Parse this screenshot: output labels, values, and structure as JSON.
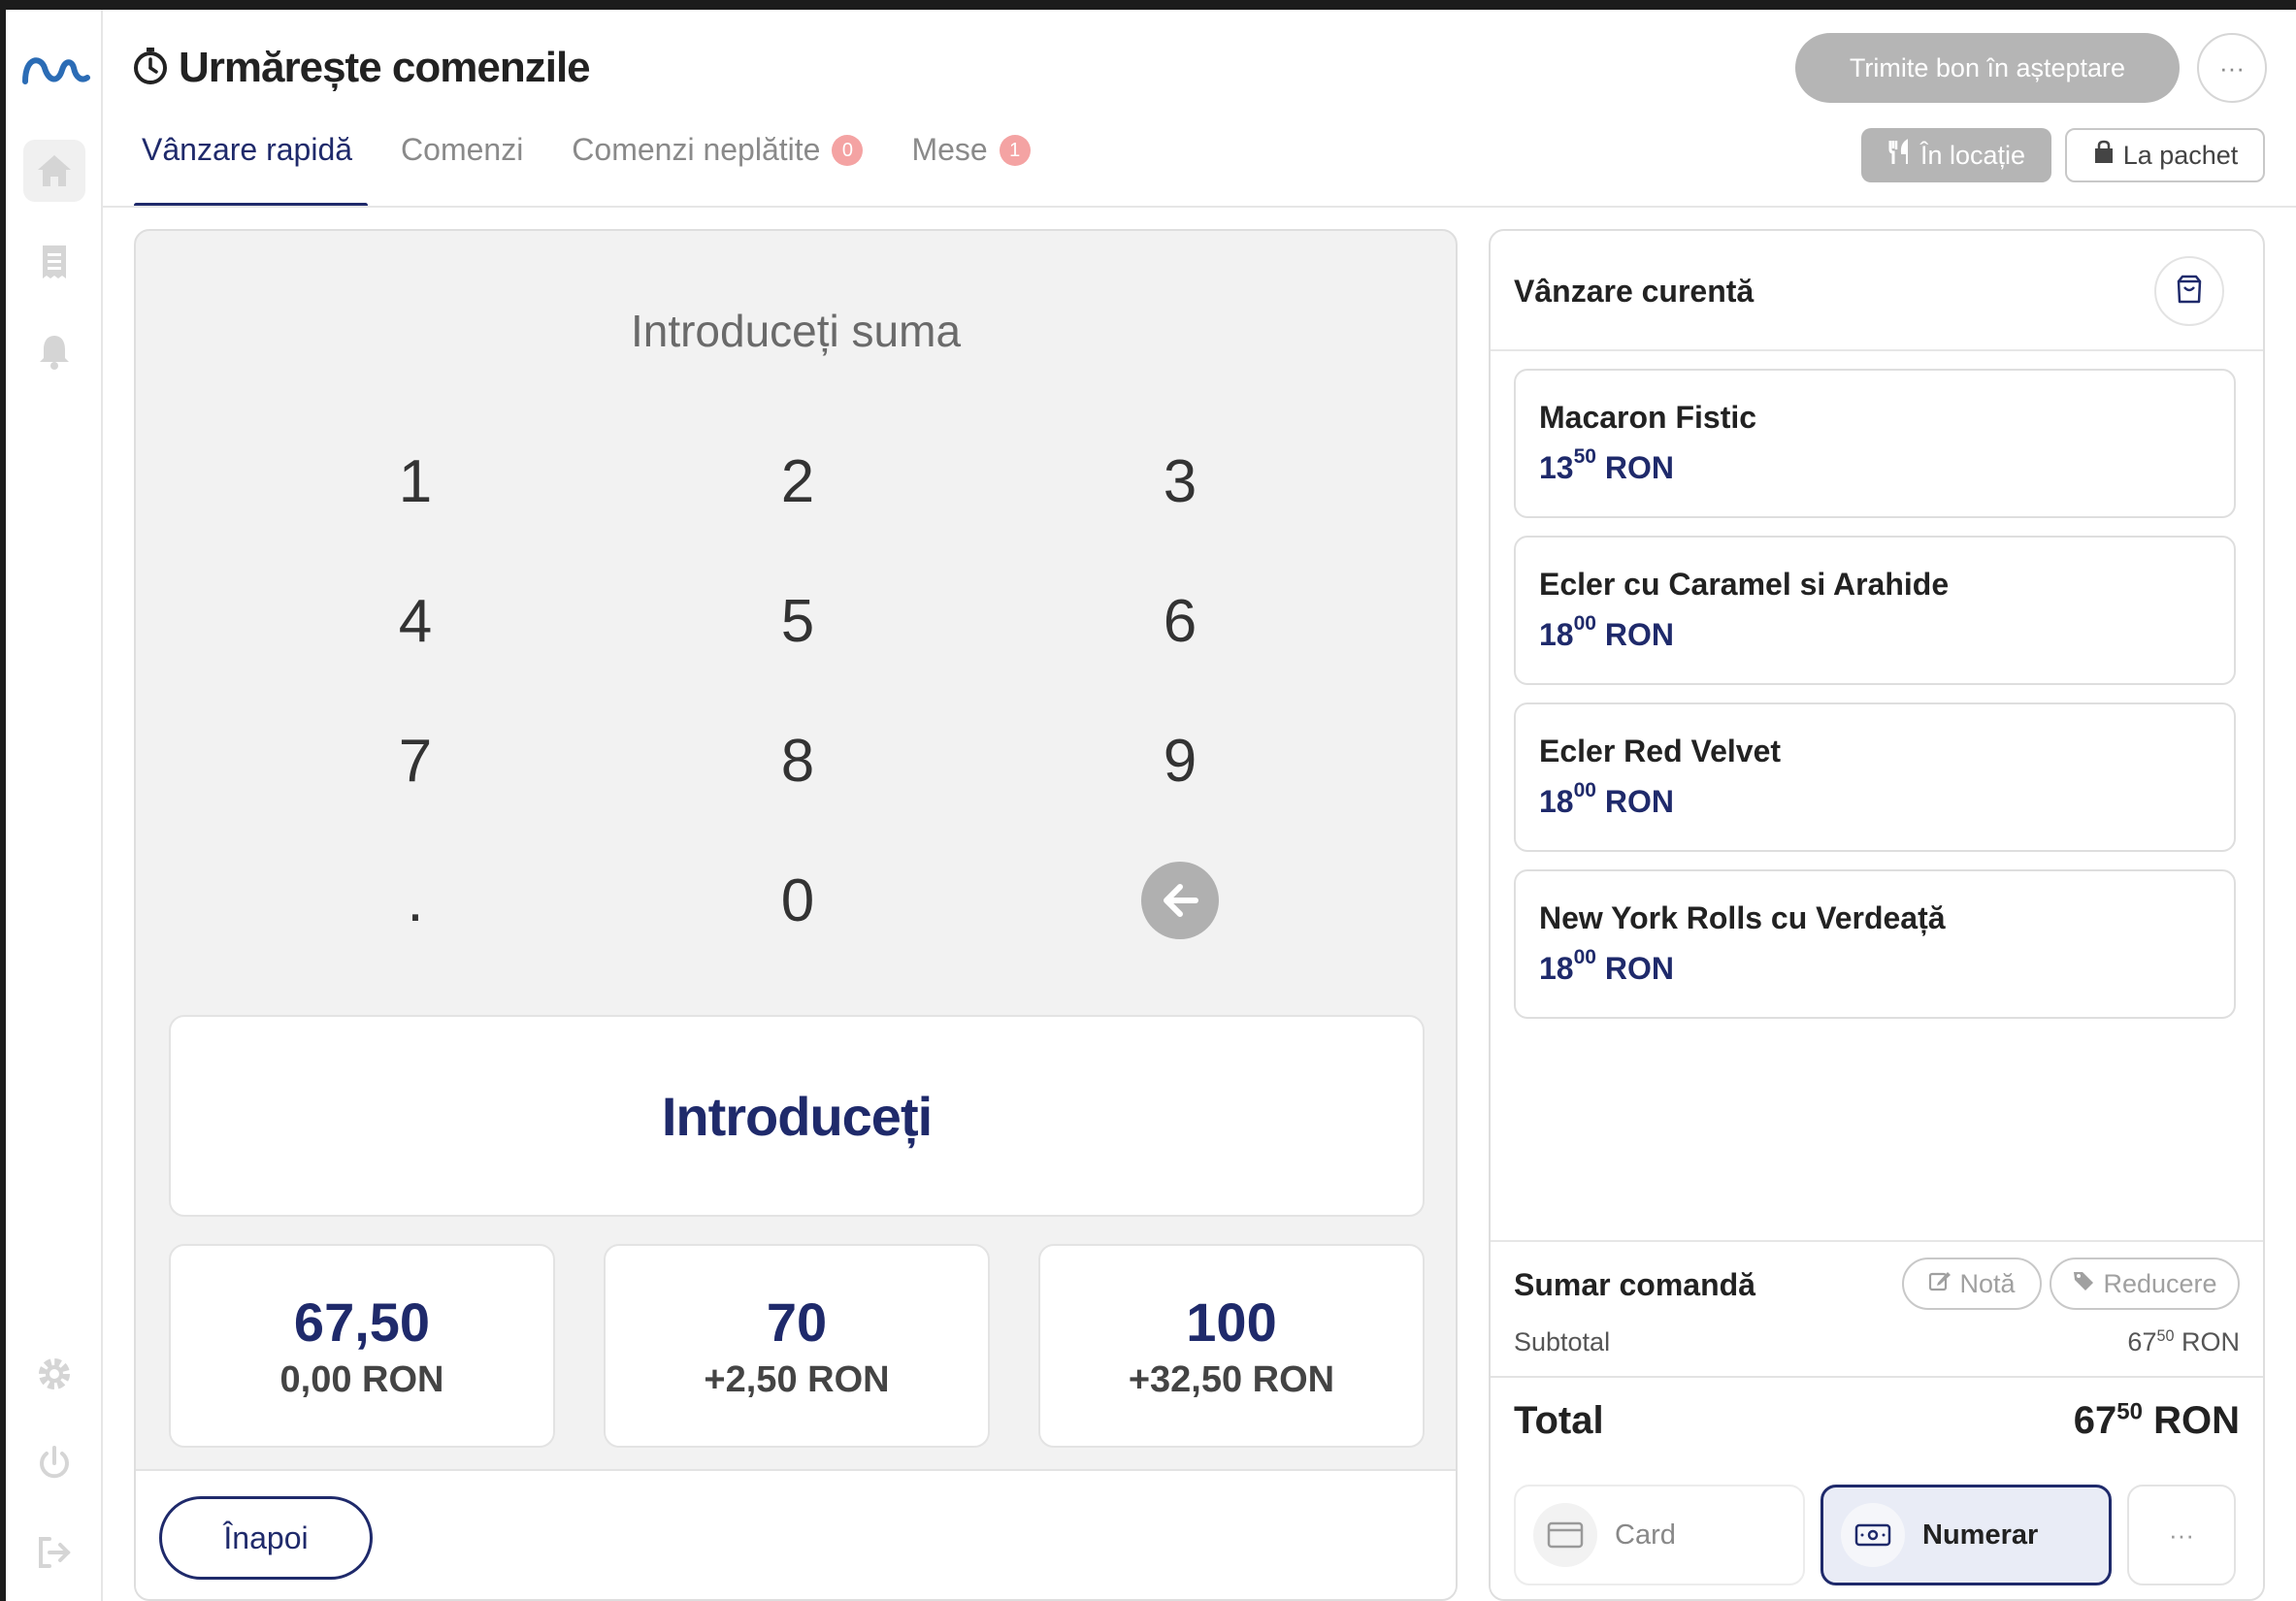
{
  "header": {
    "title": "Urmărește comenzile",
    "send_pending_label": "Trimite bon în așteptare",
    "more_label": "···"
  },
  "tabs": [
    {
      "label": "Vânzare rapidă",
      "active": true
    },
    {
      "label": "Comenzi"
    },
    {
      "label": "Comenzi neplătite",
      "badge": "0"
    },
    {
      "label": "Mese",
      "badge": "1"
    }
  ],
  "service_mode": {
    "in_location_label": "În locație",
    "takeaway_label": "La pachet"
  },
  "keypad": {
    "title": "Introduceți suma",
    "keys": [
      "1",
      "2",
      "3",
      "4",
      "5",
      "6",
      "7",
      "8",
      "9",
      ".",
      "0"
    ],
    "enter_label": "Introduceți",
    "quick_amounts": [
      {
        "amount": "67,50",
        "change": "0,00 RON"
      },
      {
        "amount": "70",
        "change": "+2,50 RON"
      },
      {
        "amount": "100",
        "change": "+32,50 RON"
      }
    ],
    "back_label": "Înapoi"
  },
  "sale": {
    "title": "Vânzare curentă",
    "items": [
      {
        "name": "Macaron Fistic",
        "price_int": "13",
        "price_dec": "50",
        "currency": "RON"
      },
      {
        "name": "Ecler cu Caramel si Arahide",
        "price_int": "18",
        "price_dec": "00",
        "currency": "RON"
      },
      {
        "name": "Ecler Red Velvet",
        "price_int": "18",
        "price_dec": "00",
        "currency": "RON"
      },
      {
        "name": "New York Rolls cu Verdeață",
        "price_int": "18",
        "price_dec": "00",
        "currency": "RON"
      }
    ]
  },
  "summary": {
    "title": "Sumar comandă",
    "note_label": "Notă",
    "discount_label": "Reducere",
    "subtotal_label": "Subtotal",
    "subtotal_int": "67",
    "subtotal_dec": "50",
    "subtotal_currency": "RON",
    "total_label": "Total",
    "total_int": "67",
    "total_dec": "50",
    "total_currency": "RON"
  },
  "payment": {
    "card_label": "Card",
    "cash_label": "Numerar",
    "more_label": "···",
    "selected": "Numerar"
  },
  "colors": {
    "accent": "#1f2a6b",
    "badge": "#f4a3a3",
    "disabled": "#b5b5b5",
    "logo": "#2b6cb5"
  },
  "icons": {
    "logo": "brand-wave-logo",
    "sidebar": [
      "home-icon",
      "receipt-icon",
      "bell-icon",
      "gear-icon",
      "power-icon",
      "logout-icon"
    ],
    "title": "stopwatch-icon"
  }
}
